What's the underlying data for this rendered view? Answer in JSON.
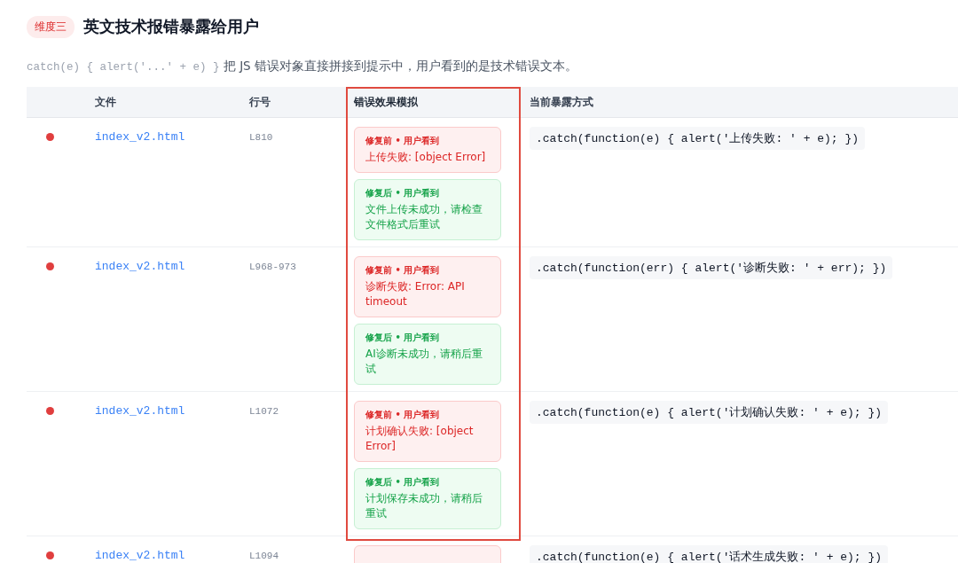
{
  "section": {
    "badge": "维度三",
    "title": "英文技术报错暴露给用户",
    "description_code": "catch(e) { alert('...' + e) }",
    "description": "把 JS 错误对象直接拼接到提示中，用户看到的是技术错误文本。"
  },
  "table": {
    "columns": [
      {
        "label": "文件",
        "highlighted": false
      },
      {
        "label": "行号",
        "highlighted": false
      },
      {
        "label": "错误效果模拟",
        "highlighted": true
      },
      {
        "label": "当前暴露方式",
        "highlighted": false
      }
    ],
    "rows": [
      {
        "file": "index_v2.html",
        "line": "L810",
        "cards": [
          {
            "kind": "before",
            "label": "修复前 • 用户看到",
            "text": "上传失败: [object Error]"
          },
          {
            "kind": "after",
            "label": "修复后 • 用户看到",
            "text": "文件上传未成功，请检查文件格式后重试"
          }
        ],
        "code": ".catch(function(e) { alert('上传失败: ' + e); })"
      },
      {
        "file": "index_v2.html",
        "line": "L968-973",
        "cards": [
          {
            "kind": "before",
            "label": "修复前 • 用户看到",
            "text": "诊断失败: Error: API timeout"
          },
          {
            "kind": "after",
            "label": "修复后 • 用户看到",
            "text": "AI诊断未成功，请稍后重试"
          }
        ],
        "code": ".catch(function(err) { alert('诊断失败: ' + err); })"
      },
      {
        "file": "index_v2.html",
        "line": "L1072",
        "cards": [
          {
            "kind": "before",
            "label": "修复前 • 用户看到",
            "text": "计划确认失败: [object Error]"
          },
          {
            "kind": "after",
            "label": "修复后 • 用户看到",
            "text": "计划保存未成功，请稍后重试"
          }
        ],
        "code": ".catch(function(e) { alert('计划确认失败: ' + e); })"
      },
      {
        "file": "index_v2.html",
        "line": "L1094",
        "cards": [
          {
            "kind": "before"
          }
        ],
        "code": ".catch(function(e) { alert('话术生成失败: ' + e); })"
      }
    ]
  }
}
